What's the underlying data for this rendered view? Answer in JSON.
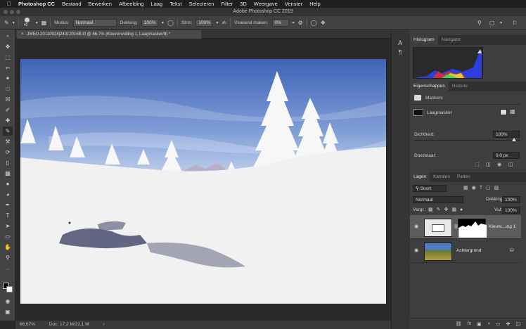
{
  "menubar": {
    "apple": "",
    "app": "Photoshop CC",
    "items": [
      "Bestand",
      "Bewerken",
      "Afbeelding",
      "Laag",
      "Tekst",
      "Selecteren",
      "Filter",
      "3D",
      "Weergave",
      "Venster",
      "Help"
    ]
  },
  "window": {
    "title": "Adobe Photoshop CC 2019"
  },
  "options": {
    "brush_size": "40",
    "mode_label": "Modus:",
    "mode_value": "Normaal",
    "opacity_label": "Dekking:",
    "opacity_value": "100%",
    "flow_label": "Strm:",
    "flow_value": "100%",
    "smoothing_label": "Vloeiend maken:",
    "smoothing_value": "0%"
  },
  "document": {
    "tab_title": "JWED-20110924|24012016B.tif @ 66,7% (Kleurenvulling 1, Laagmasker/8) *",
    "close_glyph": "×"
  },
  "status": {
    "zoom": "66,67%",
    "doc_info": "Doc: 17,2 M/22,1 M",
    "arrow": "›"
  },
  "panels": {
    "top_tabs": [
      "Histogram",
      "Navigator"
    ],
    "props_tabs": [
      "Eigenschappen",
      "Historie"
    ],
    "props_section": "Maskers",
    "mask_type": "Laagmasker",
    "density_label": "Dichtheid:",
    "density_value": "100%",
    "feather_label": "Doezelaar:",
    "feather_value": "0,0 px",
    "layer_tabs": [
      "Lagen",
      "Kanalen",
      "Paden"
    ],
    "filter_kind": "Soort",
    "blend_mode": "Normaal",
    "opacity_label": "Dekking:",
    "opacity_value": "100%",
    "lock_label": "Vergr.:",
    "fill_label": "Vul:",
    "fill_value": "100%",
    "layers": [
      {
        "name": "Kleure...ing 1",
        "selected": true
      },
      {
        "name": "Achtergrond",
        "selected": false
      }
    ]
  },
  "colors": {
    "sky_top": "#3f63b7",
    "sky_bottom": "#b8cbe9",
    "snow": "#f1f1f1",
    "panel_bg": "#3e3e3e"
  }
}
